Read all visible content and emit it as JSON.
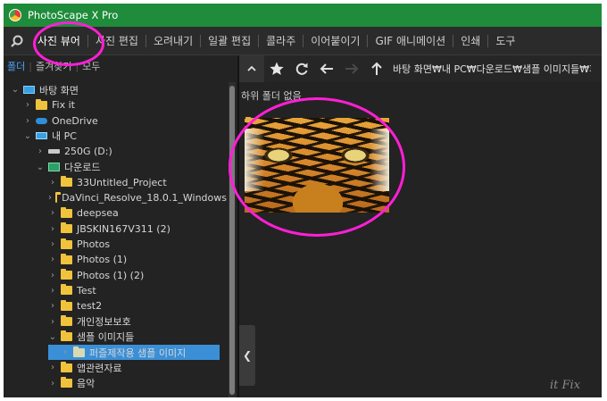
{
  "window": {
    "title": "PhotoScape X Pro"
  },
  "menu": {
    "tabs": [
      "사진 뷰어",
      "사진 편집",
      "오려내기",
      "일괄 편집",
      "콜라주",
      "이어붙이기",
      "GIF 애니메이션",
      "인쇄",
      "도구"
    ],
    "active_index": 0
  },
  "left_panel": {
    "tabs": [
      "폴더",
      "즐겨찾기",
      "모두"
    ],
    "active_tab": "폴더",
    "tree": [
      {
        "label": "바탕 화면",
        "icon": "desktop-icon",
        "level": 0,
        "expanded": true
      },
      {
        "label": "Fix it",
        "icon": "folder-icon",
        "level": 1,
        "expanded": false
      },
      {
        "label": "OneDrive",
        "icon": "onedrive-icon",
        "level": 1,
        "expanded": false
      },
      {
        "label": "내 PC",
        "icon": "pc-icon",
        "level": 1,
        "expanded": true
      },
      {
        "label": "250G (D:)",
        "icon": "drive-icon",
        "level": 2,
        "expanded": false
      },
      {
        "label": "다운로드",
        "icon": "download-folder-icon",
        "level": 2,
        "expanded": true
      },
      {
        "label": "33Untitled_Project",
        "icon": "folder-icon",
        "level": 3,
        "expanded": false
      },
      {
        "label": "DaVinci_Resolve_18.0.1_Windows",
        "icon": "folder-icon",
        "level": 3,
        "expanded": false
      },
      {
        "label": "deepsea",
        "icon": "folder-icon",
        "level": 3,
        "expanded": false
      },
      {
        "label": "JBSKIN167V311 (2)",
        "icon": "folder-icon",
        "level": 3,
        "expanded": false
      },
      {
        "label": "Photos",
        "icon": "folder-icon",
        "level": 3,
        "expanded": false
      },
      {
        "label": "Photos (1)",
        "icon": "folder-icon",
        "level": 3,
        "expanded": false
      },
      {
        "label": "Photos (1) (2)",
        "icon": "folder-icon",
        "level": 3,
        "expanded": false
      },
      {
        "label": "Test",
        "icon": "folder-icon",
        "level": 3,
        "expanded": false
      },
      {
        "label": "test2",
        "icon": "folder-icon",
        "level": 3,
        "expanded": false
      },
      {
        "label": "개인정보보호",
        "icon": "folder-icon",
        "level": 3,
        "expanded": false
      },
      {
        "label": "샘플 이미지들",
        "icon": "folder-icon",
        "level": 3,
        "expanded": true
      },
      {
        "label": "퍼즐제작용 샘플 이미지",
        "icon": "folder-icon",
        "level": 4,
        "expanded": false,
        "selected": true
      },
      {
        "label": "앱관련자료",
        "icon": "folder-icon",
        "level": 3,
        "expanded": false
      },
      {
        "label": "음악",
        "icon": "folder-icon",
        "level": 3,
        "expanded": false
      }
    ]
  },
  "right_panel": {
    "path": "바탕 화면₩내 PC₩다운로드₩샘플 이미지들₩퍼",
    "subfolder_note": "하위 폴더 없음",
    "thumbnail": {
      "subject": "tiger-face"
    }
  },
  "watermark": "it Fix",
  "colors": {
    "titlebar": "#1e8c3a",
    "selection": "#3a8fd6",
    "annotation": "#ff1fd6",
    "active_tab": "#4da3ff"
  }
}
